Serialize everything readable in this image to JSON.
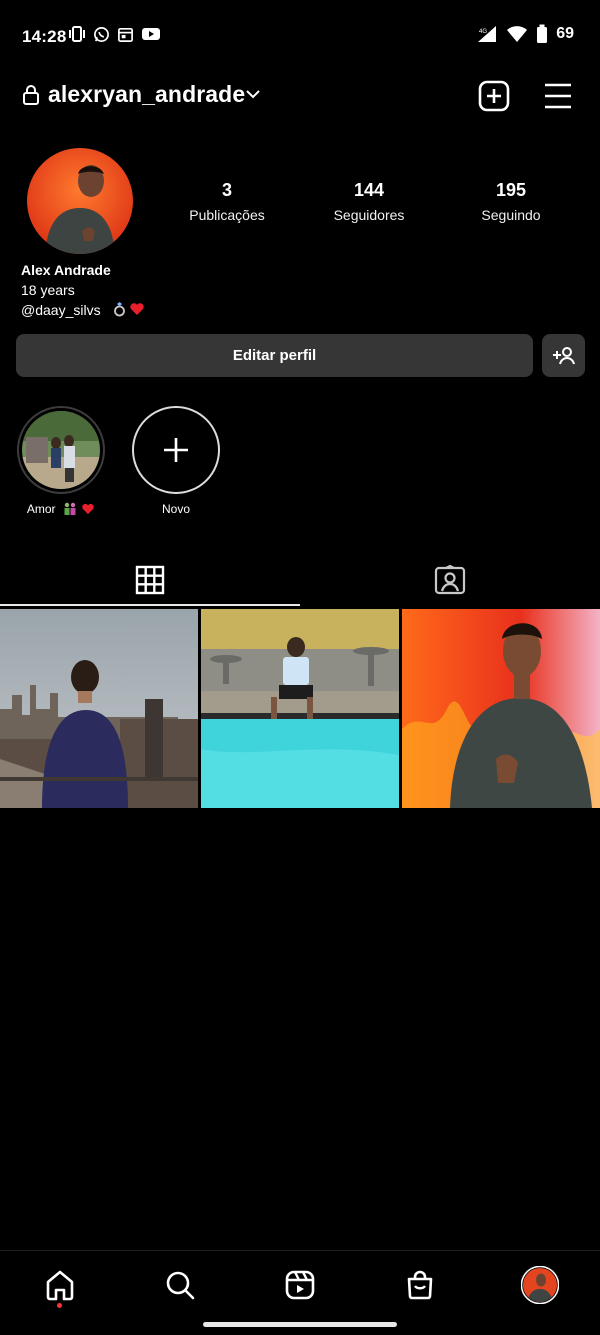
{
  "status_bar": {
    "time": "14:28",
    "battery": "69",
    "left_icons": [
      "vibrate-icon",
      "whatsapp-icon",
      "calendar-icon",
      "youtube-icon"
    ],
    "right_icons": [
      "signal-icon",
      "wifi-icon",
      "battery-icon"
    ]
  },
  "header": {
    "username": "alexryan_andrade",
    "icons": [
      "lock-icon",
      "chevron-down-icon",
      "add-post-icon",
      "menu-icon"
    ]
  },
  "profile": {
    "stats": [
      {
        "value": "3",
        "label": "Publicações"
      },
      {
        "value": "144",
        "label": "Seguidores"
      },
      {
        "value": "195",
        "label": "Seguindo"
      }
    ],
    "name": "Alex Andrade",
    "bio_line": "18 years",
    "mention": "@daay_silvs",
    "bio_emojis": [
      "ring",
      "red-heart"
    ]
  },
  "actions": {
    "edit_label": "Editar perfil"
  },
  "highlights": [
    {
      "label": "Amor",
      "emojis": [
        "couple",
        "red-heart"
      ]
    },
    {
      "label": "Novo"
    }
  ],
  "tabs": [
    "grid-icon",
    "tagged-icon"
  ],
  "posts": [
    {
      "subject": "city-view-from-rooftop"
    },
    {
      "subject": "sitting-by-pool"
    },
    {
      "subject": "portrait-orange-background"
    }
  ],
  "bottom_nav": [
    "home-icon",
    "search-icon",
    "reels-icon",
    "shop-icon",
    "profile-avatar"
  ],
  "colors": {
    "background": "#000000",
    "button": "#363636",
    "notification_dot": "#ff3040",
    "heart": "#e8202c"
  }
}
